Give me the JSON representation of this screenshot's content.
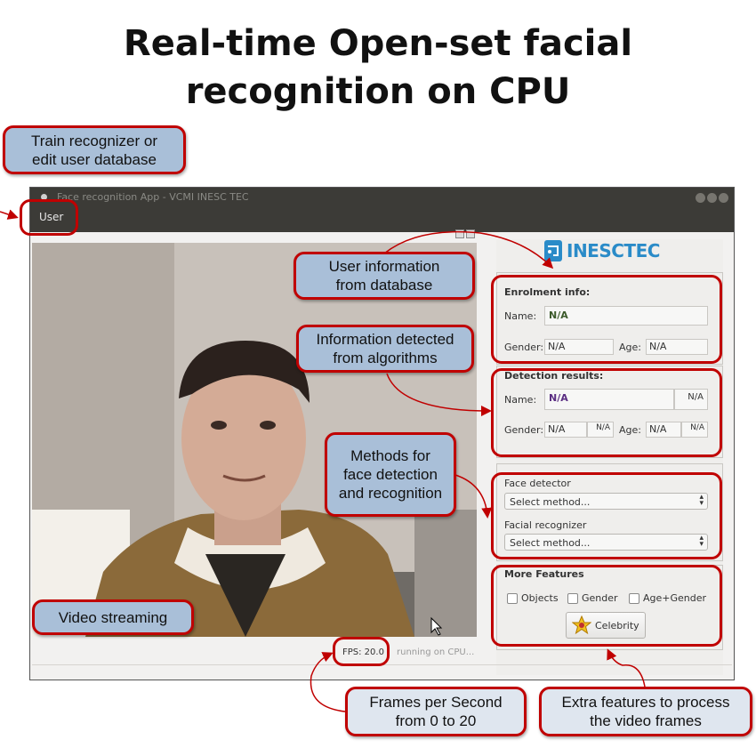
{
  "heading": {
    "line1": "Real-time Open-set facial",
    "line2": "recognition on CPU"
  },
  "window": {
    "title": "Face recognition App - VCMI INESC TEC",
    "menu": {
      "user": "User"
    }
  },
  "logo": {
    "text": "INESCTEC"
  },
  "enrolment": {
    "title": "Enrolment info:",
    "name_label": "Name:",
    "name_value": "N/A",
    "gender_label": "Gender:",
    "gender_value": "N/A",
    "age_label": "Age:",
    "age_value": "N/A"
  },
  "detection": {
    "title": "Detection results:",
    "name_label": "Name:",
    "name_value": "N/A",
    "name_score": "N/A",
    "gender_label": "Gender:",
    "gender_value": "N/A",
    "gender_score": "N/A",
    "age_label": "Age:",
    "age_value": "N/A",
    "age_score": "N/A"
  },
  "methods": {
    "detector_label": "Face detector",
    "detector_value": "Select method...",
    "recognizer_label": "Facial recognizer",
    "recognizer_value": "Select method..."
  },
  "features": {
    "title": "More Features",
    "objects": "Objects",
    "gender": "Gender",
    "age_gender": "Age+Gender",
    "celebrity": "Celebrity"
  },
  "status": {
    "fps": "FPS: 20.0",
    "running": "running on CPU..."
  },
  "callouts": {
    "train": [
      "Train recognizer or",
      "edit user database"
    ],
    "user_info": [
      "User information",
      "from database"
    ],
    "detected": [
      "Information detected",
      "from algorithms"
    ],
    "methods": [
      "Methods for",
      "face detection",
      "and recognition"
    ],
    "video": "Video streaming",
    "fps": [
      "Frames per Second",
      "from 0 to 20"
    ],
    "extra": [
      "Extra features to process",
      "the video frames"
    ]
  },
  "colors": {
    "accent_red": "#c00000",
    "callout_blue": "#a9bfd8",
    "purple_text": "#5a2d82",
    "brand_blue": "#2a8bc8"
  }
}
